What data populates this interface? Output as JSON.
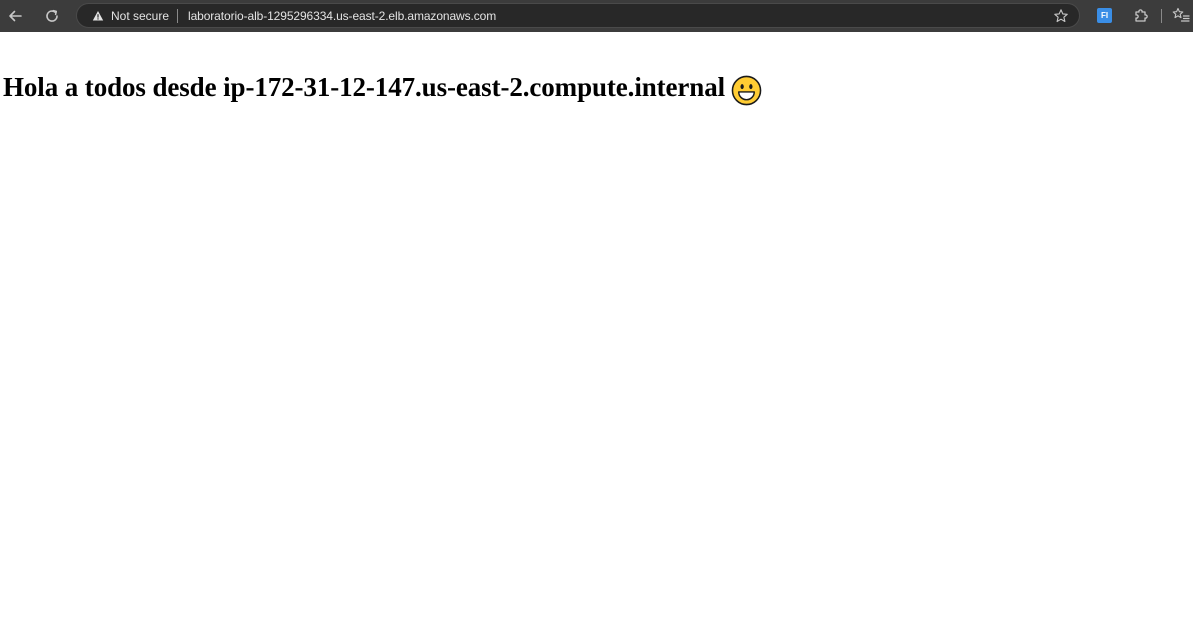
{
  "browser": {
    "security_label": "Not secure",
    "url": "laboratorio-alb-1295296334.us-east-2.elb.amazonaws.com",
    "extension_badge": "FI",
    "toolbar_color": "#3c3c3c",
    "omnibox_color": "#282828",
    "icons": [
      "back-arrow-icon",
      "reload-icon",
      "warning-icon",
      "star-icon",
      "extension-fi-icon",
      "extensions-puzzle-icon",
      "favorites-list-icon"
    ]
  },
  "page": {
    "heading": "Hola a todos desde ip-172-31-12-147.us-east-2.compute.internal",
    "emoji": "grinning-face-emoji",
    "background": "#ffffff"
  }
}
